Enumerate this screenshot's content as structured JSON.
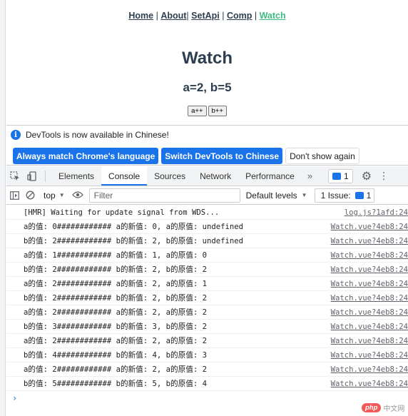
{
  "nav": {
    "home": "Home",
    "about": "About",
    "setapi": "SetApi",
    "comp": "Comp",
    "watch": "Watch",
    "sep1": " | ",
    "sep2": "| ",
    "sep3": " | ",
    "sep4": " | "
  },
  "main": {
    "title": "Watch",
    "subtitle": "a=2, b=5",
    "btn_a": "a++",
    "btn_b": "b++"
  },
  "infobar": {
    "icon": "info-icon",
    "message": "DevTools is now available in Chinese!",
    "btn_match": "Always match Chrome's language",
    "btn_switch": "Switch DevTools to Chinese",
    "btn_dismiss": "Don't show again"
  },
  "tabs": {
    "items": [
      "Elements",
      "Console",
      "Sources",
      "Network",
      "Performance"
    ],
    "active": "Console",
    "more": "»",
    "issues_count": "1"
  },
  "filter": {
    "context": "top",
    "placeholder": "Filter",
    "levels": "Default levels",
    "issues_label": "1 Issue:",
    "issues_count": "1"
  },
  "console": {
    "rows": [
      {
        "msg": "[HMR] Waiting for update signal from WDS...",
        "src": "log.js?1afd:24"
      },
      {
        "msg": "a的值: 0############ a的新值: 0, a的原值: undefined",
        "src": "Watch.vue?4eb8:24"
      },
      {
        "msg": "b的值: 2############ b的新值: 2, b的原值: undefined",
        "src": "Watch.vue?4eb8:24"
      },
      {
        "msg": "a的值: 1############ a的新值: 1, a的原值: 0",
        "src": "Watch.vue?4eb8:24"
      },
      {
        "msg": "b的值: 2############ b的新值: 2, b的原值: 2",
        "src": "Watch.vue?4eb8:24"
      },
      {
        "msg": "a的值: 2############ a的新值: 2, a的原值: 1",
        "src": "Watch.vue?4eb8:24"
      },
      {
        "msg": "b的值: 2############ b的新值: 2, b的原值: 2",
        "src": "Watch.vue?4eb8:24"
      },
      {
        "msg": "a的值: 2############ a的新值: 2, a的原值: 2",
        "src": "Watch.vue?4eb8:24"
      },
      {
        "msg": "b的值: 3############ b的新值: 3, b的原值: 2",
        "src": "Watch.vue?4eb8:24"
      },
      {
        "msg": "a的值: 2############ a的新值: 2, a的原值: 2",
        "src": "Watch.vue?4eb8:24"
      },
      {
        "msg": "b的值: 4############ b的新值: 4, b的原值: 3",
        "src": "Watch.vue?4eb8:24"
      },
      {
        "msg": "a的值: 2############ a的新值: 2, a的原值: 2",
        "src": "Watch.vue?4eb8:24"
      },
      {
        "msg": "b的值: 5############ b的新值: 5, b的原值: 4",
        "src": "Watch.vue?4eb8:24"
      }
    ],
    "prompt": "›"
  },
  "watermark": {
    "brand": "php",
    "text": "中文网"
  },
  "colors": {
    "accent": "#1a73e8",
    "nav_active": "#42b983",
    "heading": "#2c3e50"
  }
}
